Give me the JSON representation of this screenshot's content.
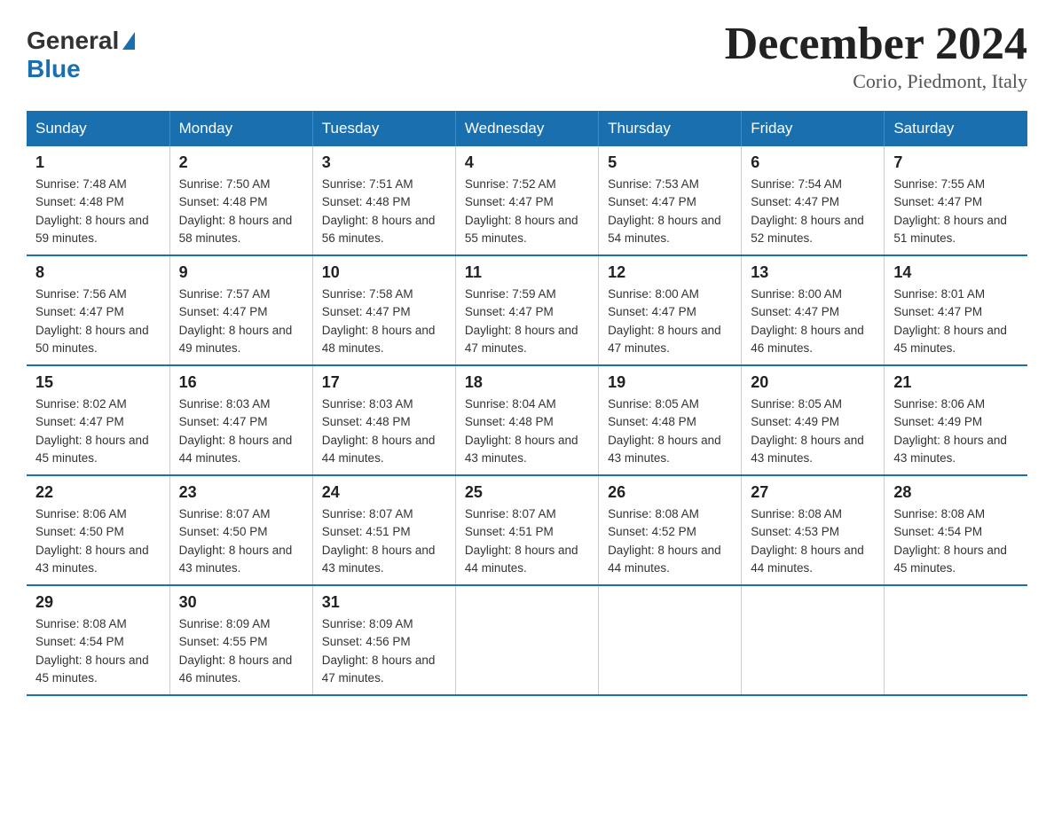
{
  "header": {
    "logo_general": "General",
    "logo_blue": "Blue",
    "title": "December 2024",
    "subtitle": "Corio, Piedmont, Italy"
  },
  "days_of_week": [
    "Sunday",
    "Monday",
    "Tuesday",
    "Wednesday",
    "Thursday",
    "Friday",
    "Saturday"
  ],
  "weeks": [
    [
      {
        "day": "1",
        "sunrise": "7:48 AM",
        "sunset": "4:48 PM",
        "daylight": "8 hours and 59 minutes."
      },
      {
        "day": "2",
        "sunrise": "7:50 AM",
        "sunset": "4:48 PM",
        "daylight": "8 hours and 58 minutes."
      },
      {
        "day": "3",
        "sunrise": "7:51 AM",
        "sunset": "4:48 PM",
        "daylight": "8 hours and 56 minutes."
      },
      {
        "day": "4",
        "sunrise": "7:52 AM",
        "sunset": "4:47 PM",
        "daylight": "8 hours and 55 minutes."
      },
      {
        "day": "5",
        "sunrise": "7:53 AM",
        "sunset": "4:47 PM",
        "daylight": "8 hours and 54 minutes."
      },
      {
        "day": "6",
        "sunrise": "7:54 AM",
        "sunset": "4:47 PM",
        "daylight": "8 hours and 52 minutes."
      },
      {
        "day": "7",
        "sunrise": "7:55 AM",
        "sunset": "4:47 PM",
        "daylight": "8 hours and 51 minutes."
      }
    ],
    [
      {
        "day": "8",
        "sunrise": "7:56 AM",
        "sunset": "4:47 PM",
        "daylight": "8 hours and 50 minutes."
      },
      {
        "day": "9",
        "sunrise": "7:57 AM",
        "sunset": "4:47 PM",
        "daylight": "8 hours and 49 minutes."
      },
      {
        "day": "10",
        "sunrise": "7:58 AM",
        "sunset": "4:47 PM",
        "daylight": "8 hours and 48 minutes."
      },
      {
        "day": "11",
        "sunrise": "7:59 AM",
        "sunset": "4:47 PM",
        "daylight": "8 hours and 47 minutes."
      },
      {
        "day": "12",
        "sunrise": "8:00 AM",
        "sunset": "4:47 PM",
        "daylight": "8 hours and 47 minutes."
      },
      {
        "day": "13",
        "sunrise": "8:00 AM",
        "sunset": "4:47 PM",
        "daylight": "8 hours and 46 minutes."
      },
      {
        "day": "14",
        "sunrise": "8:01 AM",
        "sunset": "4:47 PM",
        "daylight": "8 hours and 45 minutes."
      }
    ],
    [
      {
        "day": "15",
        "sunrise": "8:02 AM",
        "sunset": "4:47 PM",
        "daylight": "8 hours and 45 minutes."
      },
      {
        "day": "16",
        "sunrise": "8:03 AM",
        "sunset": "4:47 PM",
        "daylight": "8 hours and 44 minutes."
      },
      {
        "day": "17",
        "sunrise": "8:03 AM",
        "sunset": "4:48 PM",
        "daylight": "8 hours and 44 minutes."
      },
      {
        "day": "18",
        "sunrise": "8:04 AM",
        "sunset": "4:48 PM",
        "daylight": "8 hours and 43 minutes."
      },
      {
        "day": "19",
        "sunrise": "8:05 AM",
        "sunset": "4:48 PM",
        "daylight": "8 hours and 43 minutes."
      },
      {
        "day": "20",
        "sunrise": "8:05 AM",
        "sunset": "4:49 PM",
        "daylight": "8 hours and 43 minutes."
      },
      {
        "day": "21",
        "sunrise": "8:06 AM",
        "sunset": "4:49 PM",
        "daylight": "8 hours and 43 minutes."
      }
    ],
    [
      {
        "day": "22",
        "sunrise": "8:06 AM",
        "sunset": "4:50 PM",
        "daylight": "8 hours and 43 minutes."
      },
      {
        "day": "23",
        "sunrise": "8:07 AM",
        "sunset": "4:50 PM",
        "daylight": "8 hours and 43 minutes."
      },
      {
        "day": "24",
        "sunrise": "8:07 AM",
        "sunset": "4:51 PM",
        "daylight": "8 hours and 43 minutes."
      },
      {
        "day": "25",
        "sunrise": "8:07 AM",
        "sunset": "4:51 PM",
        "daylight": "8 hours and 44 minutes."
      },
      {
        "day": "26",
        "sunrise": "8:08 AM",
        "sunset": "4:52 PM",
        "daylight": "8 hours and 44 minutes."
      },
      {
        "day": "27",
        "sunrise": "8:08 AM",
        "sunset": "4:53 PM",
        "daylight": "8 hours and 44 minutes."
      },
      {
        "day": "28",
        "sunrise": "8:08 AM",
        "sunset": "4:54 PM",
        "daylight": "8 hours and 45 minutes."
      }
    ],
    [
      {
        "day": "29",
        "sunrise": "8:08 AM",
        "sunset": "4:54 PM",
        "daylight": "8 hours and 45 minutes."
      },
      {
        "day": "30",
        "sunrise": "8:09 AM",
        "sunset": "4:55 PM",
        "daylight": "8 hours and 46 minutes."
      },
      {
        "day": "31",
        "sunrise": "8:09 AM",
        "sunset": "4:56 PM",
        "daylight": "8 hours and 47 minutes."
      },
      null,
      null,
      null,
      null
    ]
  ]
}
